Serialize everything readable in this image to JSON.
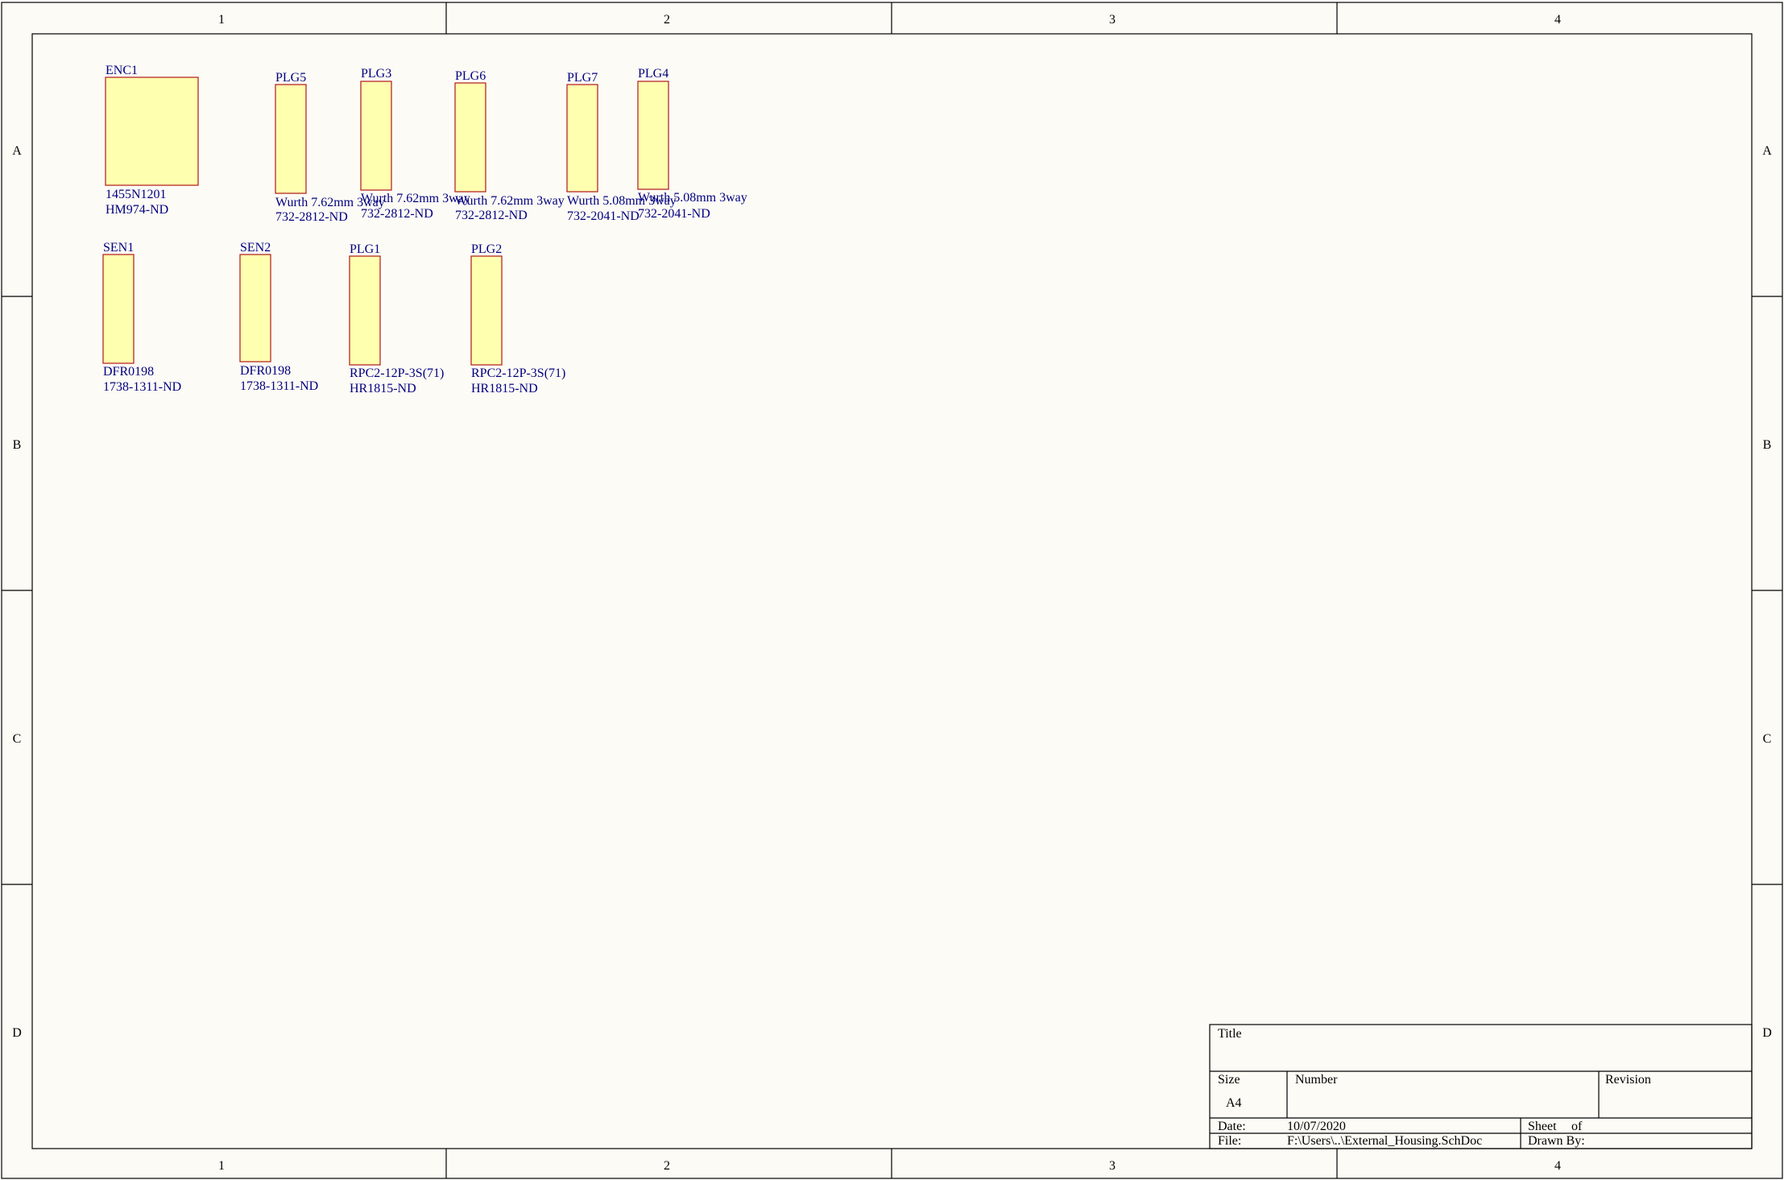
{
  "sheet": {
    "columns": [
      "1",
      "2",
      "3",
      "4"
    ],
    "rows": [
      "A",
      "B",
      "C",
      "D"
    ],
    "colors": {
      "paper": "#fdfbf5",
      "border": "#000000",
      "component_fill": "#ffffb0",
      "component_stroke": "#b01818",
      "label": "#000080"
    }
  },
  "components": [
    {
      "designator": "ENC1",
      "line1": "1455N1201",
      "line2": "HM974-ND"
    },
    {
      "designator": "PLG5",
      "line1": "Wurth 7.62mm 3way",
      "line2": "732-2812-ND"
    },
    {
      "designator": "PLG3",
      "line1": "Wurth 7.62mm 3way",
      "line2": "732-2812-ND"
    },
    {
      "designator": "PLG6",
      "line1": "Wurth 7.62mm 3way",
      "line2": "732-2812-ND"
    },
    {
      "designator": "PLG7",
      "line1": "Wurth 5.08mm 3way",
      "line2": "732-2041-ND"
    },
    {
      "designator": "PLG4",
      "line1": "Wurth 5.08mm 3way",
      "line2": "732-2041-ND"
    },
    {
      "designator": "SEN1",
      "line1": "DFR0198",
      "line2": "1738-1311-ND"
    },
    {
      "designator": "SEN2",
      "line1": "DFR0198",
      "line2": "1738-1311-ND"
    },
    {
      "designator": "PLG1",
      "line1": "RPC2-12P-3S(71)",
      "line2": "HR1815-ND"
    },
    {
      "designator": "PLG2",
      "line1": "RPC2-12P-3S(71)",
      "line2": "HR1815-ND"
    }
  ],
  "title_block": {
    "title_label": "Title",
    "title_value": "",
    "size_label": "Size",
    "size_value": "A4",
    "number_label": "Number",
    "number_value": "",
    "revision_label": "Revision",
    "revision_value": "",
    "date_label": "Date:",
    "date_value": "10/07/2020",
    "sheet_label": "Sheet",
    "of_label": "of",
    "file_label": "File:",
    "file_value": "F:\\Users\\..\\External_Housing.SchDoc",
    "drawn_by_label": "Drawn By:"
  }
}
